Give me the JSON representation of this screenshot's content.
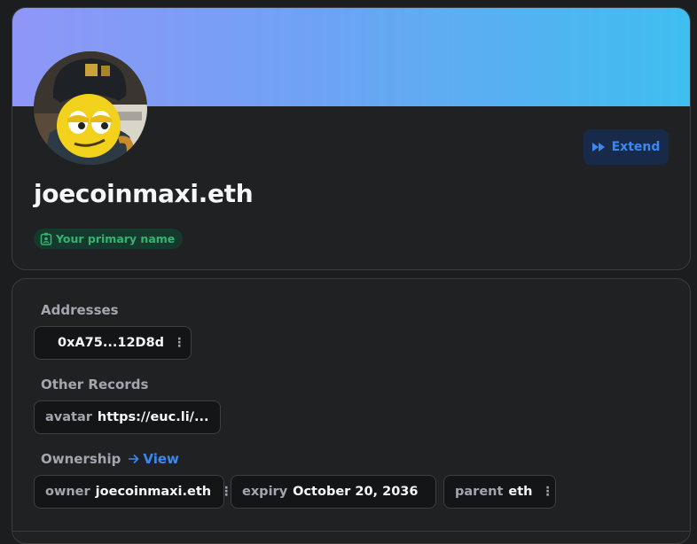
{
  "profile": {
    "name": "joecoinmaxi.eth",
    "primary_badge": "Your primary name",
    "extend_label": "Extend"
  },
  "addresses": {
    "label": "Addresses",
    "eth_address": "0xA75...12D8d"
  },
  "other_records": {
    "label": "Other Records",
    "avatar_key": "avatar",
    "avatar_value": "https://euc.li/..."
  },
  "ownership": {
    "label": "Ownership",
    "view_label": "View",
    "owner_key": "owner",
    "owner_value": "joecoinmaxi.eth",
    "expiry_key": "expiry",
    "expiry_value": "October 20, 2036",
    "parent_key": "parent",
    "parent_value": "eth"
  },
  "colors": {
    "accent": "#3d88f0",
    "success": "#35b371",
    "banner_start": "#8f96f7",
    "banner_end": "#3fbef0"
  }
}
